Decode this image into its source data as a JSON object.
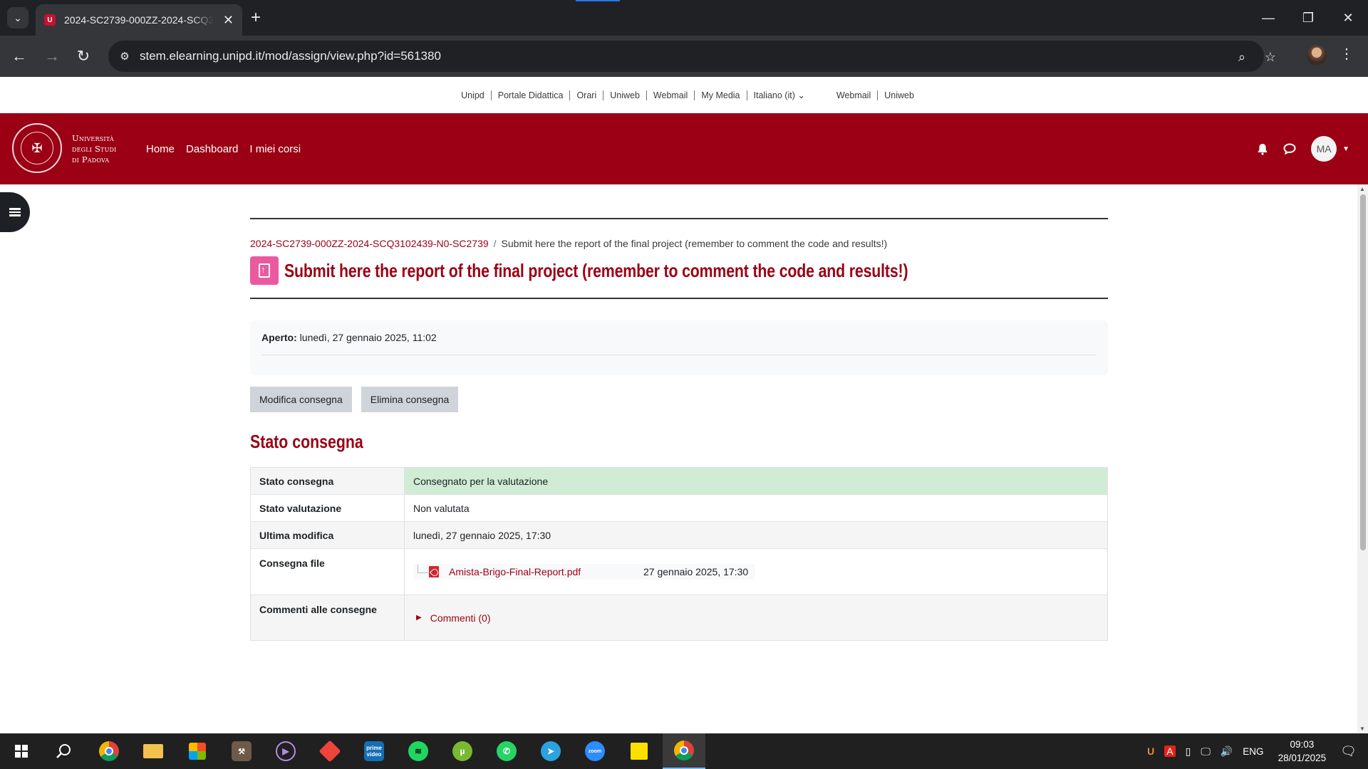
{
  "browser": {
    "tab_title": "2024-SC2739-000ZZ-2024-SCQ3102439-N0-SC2739",
    "tab_favicon": "U",
    "url": "stem.elearning.unipd.it/mod/assign/view.php?id=561380",
    "new_tab": "+",
    "close_tab": "✕",
    "tab_list": "⌄"
  },
  "utility_links": [
    "Unipd",
    "Portale Didattica",
    "Orari",
    "Uniweb",
    "Webmail",
    "My Media",
    "Italiano (it)",
    "Webmail",
    "Uniweb"
  ],
  "brand": {
    "line1": "Università",
    "line2": "degli Studi",
    "line3": "di Padova",
    "seal_glyph": "✠"
  },
  "nav": {
    "home": "Home",
    "dashboard": "Dashboard",
    "courses": "I miei corsi",
    "avatar_initials": "MA"
  },
  "breadcrumb": {
    "course": "2024-SC2739-000ZZ-2024-SCQ3102439-N0-SC2739",
    "separator": "/",
    "current": "Submit here the report of the final project (remember to comment the code and results!)"
  },
  "page_title": "Submit here the report of the final project (remember to comment the code and results!)",
  "dates": {
    "opened_label": "Aperto:",
    "opened_value": "lunedì, 27 gennaio 2025, 11:02"
  },
  "buttons": {
    "edit": "Modifica consegna",
    "delete": "Elimina consegna"
  },
  "section_title": "Stato consegna",
  "status_table": {
    "rows": [
      {
        "label": "Stato consegna",
        "value": "Consegnato per la valutazione"
      },
      {
        "label": "Stato valutazione",
        "value": "Non valutata"
      },
      {
        "label": "Ultima modifica",
        "value": "lunedì, 27 gennaio 2025, 17:30"
      },
      {
        "label": "Consegna file",
        "file_name": "Amista-Brigo-Final-Report.pdf",
        "file_date": "27 gennaio 2025, 17:30"
      },
      {
        "label": "Commenti alle consegne",
        "value": "Commenti (0)"
      }
    ]
  },
  "taskbar": {
    "language": "ENG",
    "time": "09:03",
    "date": "28/01/2025"
  },
  "colors": {
    "brand_red": "#9b0014",
    "success_bg": "#d1ecd4",
    "activity_pink": "#ea5aa0"
  }
}
